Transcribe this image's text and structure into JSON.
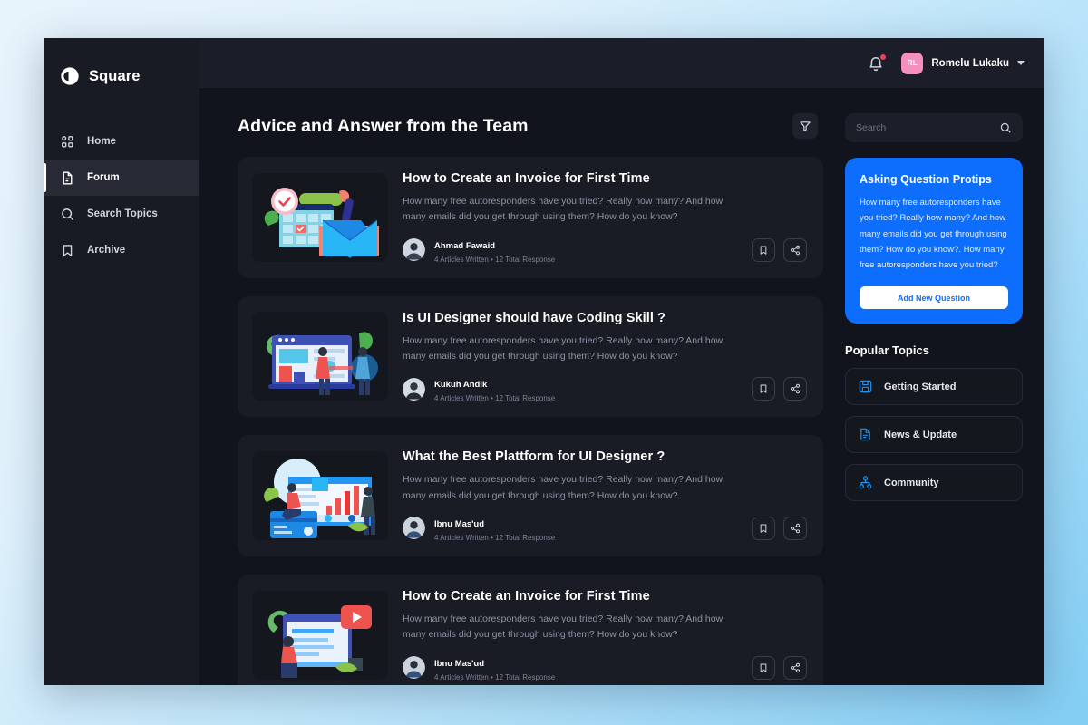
{
  "brand": {
    "name": "Square",
    "logo_icon": "square-logo-icon"
  },
  "sidebar": {
    "items": [
      {
        "label": "Home",
        "icon": "grid-icon",
        "active": false
      },
      {
        "label": "Forum",
        "icon": "document-icon",
        "active": true
      },
      {
        "label": "Search Topics",
        "icon": "search-icon",
        "active": false
      },
      {
        "label": "Archive",
        "icon": "bookmark-icon",
        "active": false
      }
    ]
  },
  "topbar": {
    "notification_icon": "bell-icon",
    "has_notification": true,
    "user": {
      "initials": "RL",
      "name": "Romelu Lukaku",
      "avatar_color": "#f48fc0"
    },
    "caret_icon": "chevron-down-icon"
  },
  "feed": {
    "title": "Advice and Answer from the Team",
    "filter_icon": "filter-icon",
    "cards": [
      {
        "title": "How to Create an Invoice for First Time",
        "desc": "How many free autoresponders have you tried? Really how many? And how many emails did you get through using them? How do you know?",
        "author": "Ahmad Fawaid",
        "meta": "4 Articles Written • 12 Total Response",
        "thumb": "invoice-calendar-illustration",
        "bookmark_icon": "bookmark-icon",
        "share_icon": "share-icon"
      },
      {
        "title": "Is UI Designer should have Coding Skill ?",
        "desc": "How many free autoresponders have you tried? Really how many? And how many emails did you get through using them? How do you know?",
        "author": "Kukuh Andik",
        "meta": "4 Articles Written • 12 Total Response",
        "thumb": "browser-team-illustration",
        "bookmark_icon": "bookmark-icon",
        "share_icon": "share-icon"
      },
      {
        "title": "What the Best Plattform for UI Designer ?",
        "desc": "How many free autoresponders have you tried? Really how many? And how many emails did you get through using them? How do you know?",
        "author": "Ibnu Mas'ud",
        "meta": "4 Articles Written • 12 Total Response",
        "thumb": "dashboard-chart-illustration",
        "bookmark_icon": "bookmark-icon",
        "share_icon": "share-icon"
      },
      {
        "title": "How to Create an Invoice for First Time",
        "desc": "How many free autoresponders have you tried? Really how many? And how many emails did you get through using them? How do you know?",
        "author": "Ibnu Mas'ud",
        "meta": "4 Articles Written • 12 Total Response",
        "thumb": "video-article-illustration",
        "bookmark_icon": "bookmark-icon",
        "share_icon": "share-icon"
      }
    ]
  },
  "aside": {
    "search": {
      "placeholder": "Search",
      "value": "",
      "icon": "search-icon"
    },
    "promo": {
      "title": "Asking Question Protips",
      "text": "How many free autoresponders have you tried? Really how many? And how many emails did you get through using them? How do you know?. How many free autoresponders have you tried?",
      "button": "Add New Question",
      "accent_color": "#0d6efd"
    },
    "topics_title": "Popular Topics",
    "topics": [
      {
        "label": "Getting Started",
        "icon": "save-disk-icon"
      },
      {
        "label": "News & Update",
        "icon": "document-lines-icon"
      },
      {
        "label": "Community",
        "icon": "network-nodes-icon"
      }
    ],
    "topic_icon_color": "#2196f3"
  }
}
